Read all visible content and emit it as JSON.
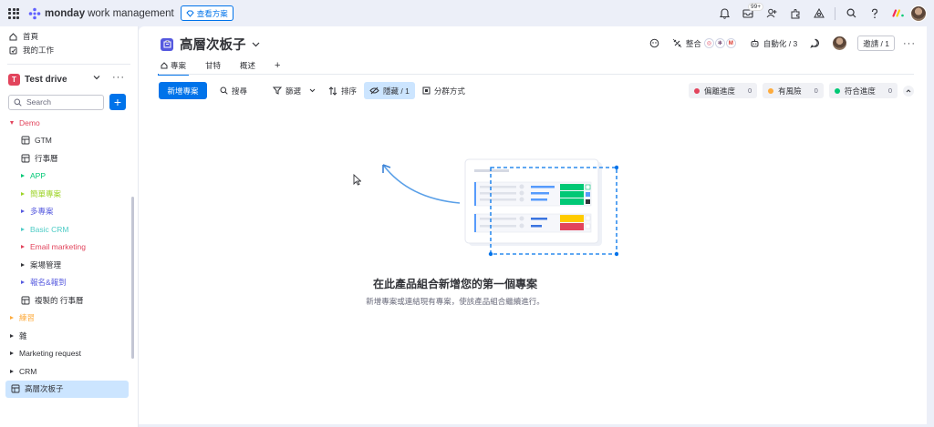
{
  "topbar": {
    "brand": "monday",
    "brand_sub": "work management",
    "plans_label": "查看方案",
    "notif_badge": "99+"
  },
  "sidebar": {
    "nav": [
      {
        "label": "首頁",
        "icon": "home-icon"
      },
      {
        "label": "我的工作",
        "icon": "my-work-icon"
      }
    ],
    "workspace": {
      "name": "Test drive",
      "initial": "T"
    },
    "search_placeholder": "Search",
    "tree": [
      {
        "label": "Demo",
        "kind": "folder-open",
        "color": "#e2445c",
        "indent": 0
      },
      {
        "label": "GTM",
        "kind": "board",
        "color": "#323338",
        "indent": 1
      },
      {
        "label": "行事曆",
        "kind": "board",
        "color": "#323338",
        "indent": 1
      },
      {
        "label": "APP",
        "kind": "folder",
        "color": "#00c875",
        "indent": 1
      },
      {
        "label": "簡單專案",
        "kind": "folder",
        "color": "#9cd326",
        "indent": 1
      },
      {
        "label": "多專案",
        "kind": "folder",
        "color": "#5559df",
        "indent": 1
      },
      {
        "label": "Basic CRM",
        "kind": "folder",
        "color": "#4eccc6",
        "indent": 1
      },
      {
        "label": "Email marketing",
        "kind": "folder",
        "color": "#e2445c",
        "indent": 1
      },
      {
        "label": "案場管理",
        "kind": "folder",
        "color": "#323338",
        "indent": 1
      },
      {
        "label": "報名&報到",
        "kind": "folder",
        "color": "#5559df",
        "indent": 1
      },
      {
        "label": "複製的 行事曆",
        "kind": "board",
        "color": "#323338",
        "indent": 1
      },
      {
        "label": "練習",
        "kind": "folder",
        "color": "#fdab3d",
        "indent": 0
      },
      {
        "label": "雜",
        "kind": "folder",
        "color": "#323338",
        "indent": 0
      },
      {
        "label": "Marketing request",
        "kind": "folder",
        "color": "#323338",
        "indent": 0
      },
      {
        "label": "CRM",
        "kind": "folder",
        "color": "#323338",
        "indent": 0
      },
      {
        "label": "高層次板子",
        "kind": "board-active",
        "color": "#323338",
        "indent": 0
      }
    ]
  },
  "header": {
    "title": "高層次板子",
    "integrate_label": "整合",
    "automate_label": "自動化 / 3",
    "invite_label": "邀請 / 1"
  },
  "tabs": [
    {
      "label": "專案",
      "active": true
    },
    {
      "label": "甘特",
      "active": false
    },
    {
      "label": "概述",
      "active": false
    }
  ],
  "toolbar": {
    "new_label": "新增專案",
    "search_label": "搜尋",
    "filter_label": "篩選",
    "sort_label": "排序",
    "hide_label": "隱藏 / 1",
    "group_label": "分群方式"
  },
  "status_chips": [
    {
      "label": "偏離進度",
      "count": "0",
      "color": "#e2445c"
    },
    {
      "label": "有風險",
      "count": "0",
      "color": "#fdab3d"
    },
    {
      "label": "符合進度",
      "count": "0",
      "color": "#00c875"
    }
  ],
  "empty_state": {
    "title": "在此產品組合新增您的第一個專案",
    "subtitle": "新增專案或連結現有專案，使該產品組合繼續進行。"
  }
}
